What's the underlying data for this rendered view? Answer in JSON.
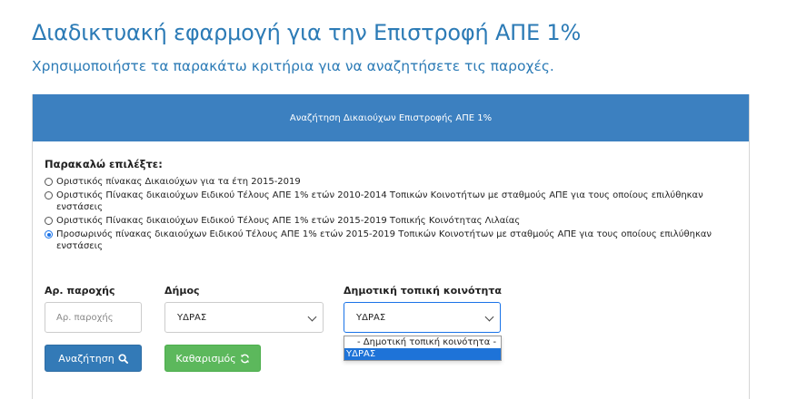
{
  "header": {
    "title": "Διαδικτυακή εφαρμογή για την Επιστροφή ΑΠΕ 1%",
    "subtitle": "Χρησιμοποιήστε τα παρακάτω κριτήρια για να αναζητήσετε τις παροχές."
  },
  "panel": {
    "title": "Αναζήτηση Δικαιούχων Επιστροφής ΑΠΕ 1%",
    "choose_label": "Παρακαλώ επιλέξτε:",
    "options": [
      {
        "label": "Οριστικός πίνακας Δικαιούχων για τα έτη 2015-2019",
        "checked": false
      },
      {
        "label": "Οριστικός Πίνακας δικαιούχων Ειδικού Τέλους ΑΠΕ 1% ετών 2010-2014 Τοπικών Κοινοτήτων με σταθμούς ΑΠΕ για τους οποίους επιλύθηκαν ενστάσεις",
        "checked": false
      },
      {
        "label": "Οριστικός Πίνακας δικαιούχων Ειδικού Τέλους ΑΠΕ 1% ετών 2015-2019 Τοπικής Κοινότητας Λιλαίας",
        "checked": false
      },
      {
        "label": "Προσωρινός πίνακας δικαιούχων Ειδικού Τέλους ΑΠΕ 1% ετών 2015-2019 Τοπικών Κοινοτήτων με σταθμούς ΑΠΕ για τους οποίους επιλύθηκαν ενστάσεις",
        "checked": true
      }
    ]
  },
  "form": {
    "provision_label": "Αρ. παροχής",
    "provision_placeholder": "Αρ. παροχής",
    "provision_value": "",
    "municipality_label": "Δήμος",
    "municipality_value": "ΥΔΡΑΣ",
    "community_label": "Δημοτική τοπική κοινότητα",
    "community_value": "ΥΔΡΑΣ",
    "community_options": [
      {
        "label": "- Δημοτική τοπική κοινότητα -",
        "selected": false
      },
      {
        "label": "ΥΔΡΑΣ",
        "selected": true
      }
    ]
  },
  "buttons": {
    "search_label": "Αναζήτηση",
    "search_icon": "search-icon",
    "clear_label": "Καθαρισμός",
    "clear_icon": "refresh-icon"
  },
  "colors": {
    "title": "#2c7bb6",
    "panel_header": "#3c80c0",
    "search_button": "#337ab7",
    "clear_button": "#5cb85c",
    "dropdown_highlight": "#1e73d8"
  }
}
